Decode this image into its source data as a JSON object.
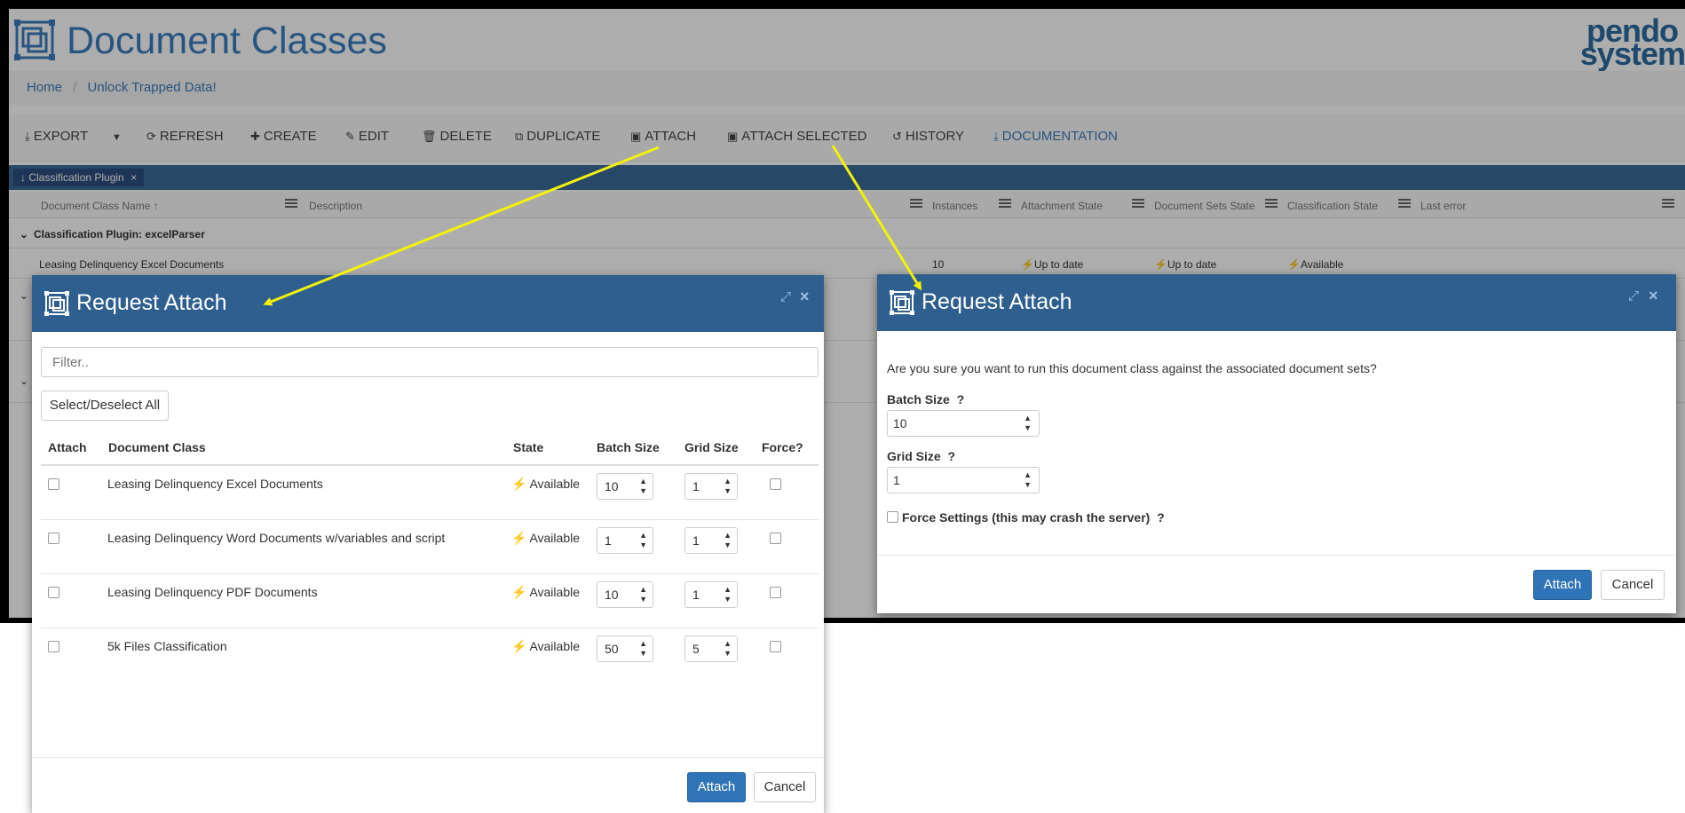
{
  "app": {
    "title": "Document Classes",
    "brand_line1": "pendo",
    "brand_line2": "system"
  },
  "breadcrumb": [
    "Home",
    "Unlock Trapped Data!"
  ],
  "toolbar": {
    "export": "EXPORT",
    "refresh": "REFRESH",
    "create": "CREATE",
    "edit": "EDIT",
    "delete": "DELETE",
    "duplicate": "DUPLICATE",
    "attach": "ATTACH",
    "attach_selected": "ATTACH SELECTED",
    "history": "HISTORY",
    "documentation": "DOCUMENTATION"
  },
  "group_chip": "Classification Plugin",
  "grid": {
    "headers": {
      "name": "Document Class Name",
      "description": "Description",
      "instances": "Instances",
      "attachment_state": "Attachment State",
      "document_sets_state": "Document Sets State",
      "classification_state": "Classification State",
      "last_error": "Last error"
    },
    "group_label": "Classification Plugin: excelParser",
    "row": {
      "name": "Leasing Delinquency Excel Documents",
      "instances": "10",
      "attachment_state": "Up to date",
      "document_sets_state": "Up to date",
      "classification_state": "Available"
    }
  },
  "modal_left": {
    "title": "Request Attach",
    "filter_placeholder": "Filter..",
    "select_all": "Select/Deselect All",
    "columns": {
      "attach": "Attach",
      "document_class": "Document Class",
      "state": "State",
      "batch_size": "Batch Size",
      "grid_size": "Grid Size",
      "force": "Force?"
    },
    "rows": [
      {
        "name": "Leasing Delinquency Excel Documents",
        "state": "Available",
        "batch": "10",
        "grid": "1"
      },
      {
        "name": "Leasing Delinquency Word Documents w/variables and script",
        "state": "Available",
        "batch": "1",
        "grid": "1"
      },
      {
        "name": "Leasing Delinquency PDF Documents",
        "state": "Available",
        "batch": "10",
        "grid": "1"
      },
      {
        "name": "5k Files Classification",
        "state": "Available",
        "batch": "50",
        "grid": "5"
      }
    ],
    "attach_button": "Attach",
    "cancel_button": "Cancel"
  },
  "modal_right": {
    "title": "Request Attach",
    "confirm": "Are you sure you want to run this document class against the associated document sets?",
    "batch_label": "Batch Size",
    "batch_value": "10",
    "grid_label": "Grid Size",
    "grid_value": "1",
    "force_label": "Force Settings (this may crash the server)",
    "help": "?",
    "attach_button": "Attach",
    "cancel_button": "Cancel"
  },
  "colors": {
    "primary": "#2e5f8f",
    "button": "#2f74b7",
    "accent_text": "#3a7dbf",
    "success": "#2d8a2d",
    "arrow": "#f2f20a"
  }
}
